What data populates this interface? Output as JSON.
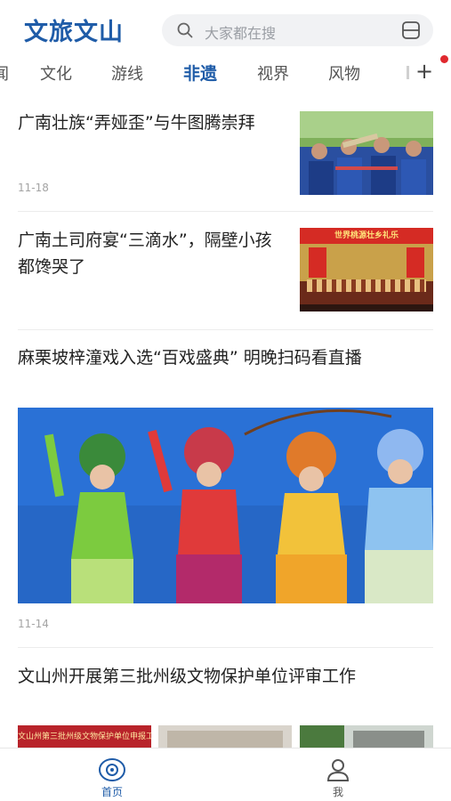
{
  "header": {
    "logo": "文旅文山",
    "search_placeholder": "大家都在搜"
  },
  "tabs": [
    {
      "label": "闻"
    },
    {
      "label": "文化"
    },
    {
      "label": "游线"
    },
    {
      "label": "非遗",
      "active": true
    },
    {
      "label": "视界"
    },
    {
      "label": "风物"
    }
  ],
  "news": [
    {
      "title": "广南壮族“弄娅歪”与牛图腾崇拜",
      "date": "11-18",
      "image": "ethnic-performers-playing-horns"
    },
    {
      "title": "广南土司府宴“三滴水”，隔壁小孩都馋哭了",
      "image": "stage-performance-banner"
    },
    {
      "title": "麻栗坡梓潼戏入选“百戏盛典” 明晚扫码看直播",
      "date": "11-14",
      "image": "opera-performers-in-costumes"
    },
    {
      "title": "文山州开展第三批州级文物保护单位评审工作",
      "images": [
        "report-banner-photo",
        "meeting-room-photo",
        "heritage-building-photo"
      ]
    }
  ],
  "thumb_captions": {
    "stage_banner": "世界桃源壮乡礼乐",
    "report_banner": "文山州第三批州级文物保护单位申报工作"
  },
  "bottom_nav": [
    {
      "label": "首页",
      "icon": "home-icon",
      "active": true
    },
    {
      "label": "我",
      "icon": "profile-icon",
      "active": false
    }
  ],
  "colors": {
    "brand": "#1f5ca8",
    "active_tab": "#1f5ca8",
    "notification_dot": "#e0282e"
  }
}
